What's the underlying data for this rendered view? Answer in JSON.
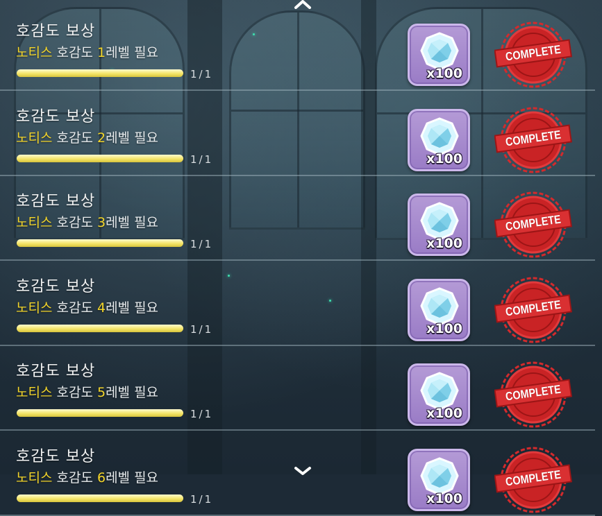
{
  "colors": {
    "highlight": "#f4d62a",
    "progress_fill": "#f4e56a",
    "reward_bg": "#a88cd0",
    "stamp_red": "#d42a2c"
  },
  "list": {
    "rows": [
      {
        "title": "호감도 보상",
        "req_name": "노티스",
        "req_mid": " 호감도 ",
        "req_level": "1",
        "req_suffix": "레벨 필요",
        "progress_text": "1/1",
        "progress": 1.0,
        "reward_icon": "gem-icon",
        "reward_qty": "x100",
        "status": "COMPLETE"
      },
      {
        "title": "호감도 보상",
        "req_name": "노티스",
        "req_mid": " 호감도 ",
        "req_level": "2",
        "req_suffix": "레벨 필요",
        "progress_text": "1/1",
        "progress": 1.0,
        "reward_icon": "gem-icon",
        "reward_qty": "x100",
        "status": "COMPLETE"
      },
      {
        "title": "호감도 보상",
        "req_name": "노티스",
        "req_mid": " 호감도 ",
        "req_level": "3",
        "req_suffix": "레벨 필요",
        "progress_text": "1/1",
        "progress": 1.0,
        "reward_icon": "gem-icon",
        "reward_qty": "x100",
        "status": "COMPLETE"
      },
      {
        "title": "호감도 보상",
        "req_name": "노티스",
        "req_mid": " 호감도 ",
        "req_level": "4",
        "req_suffix": "레벨 필요",
        "progress_text": "1/1",
        "progress": 1.0,
        "reward_icon": "gem-icon",
        "reward_qty": "x100",
        "status": "COMPLETE"
      },
      {
        "title": "호감도 보상",
        "req_name": "노티스",
        "req_mid": " 호감도 ",
        "req_level": "5",
        "req_suffix": "레벨 필요",
        "progress_text": "1/1",
        "progress": 1.0,
        "reward_icon": "gem-icon",
        "reward_qty": "x100",
        "status": "COMPLETE"
      },
      {
        "title": "호감도 보상",
        "req_name": "노티스",
        "req_mid": " 호감도 ",
        "req_level": "6",
        "req_suffix": "레벨 필요",
        "progress_text": "1/1",
        "progress": 1.0,
        "reward_icon": "gem-icon",
        "reward_qty": "x100",
        "status": "COMPLETE"
      }
    ]
  },
  "nav": {
    "scroll_up_icon": "chevron-up-icon",
    "scroll_down_icon": "chevron-down-icon"
  }
}
